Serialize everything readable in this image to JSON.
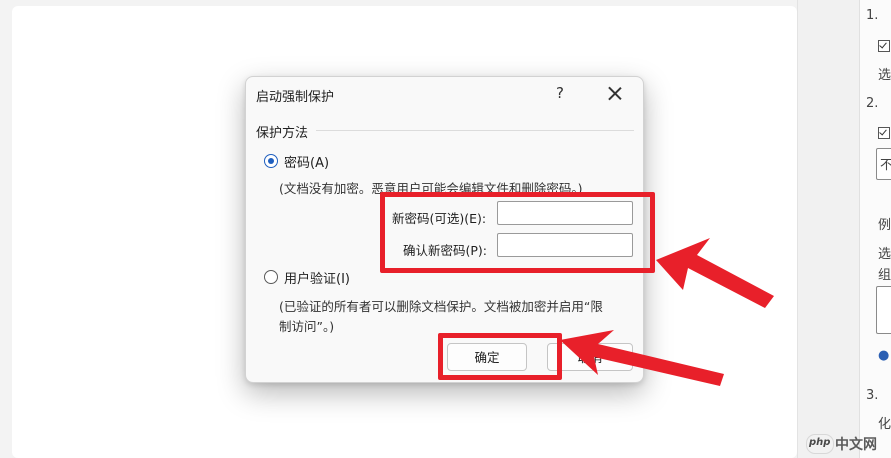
{
  "dialog": {
    "title": "启动强制保护",
    "help": "?",
    "group_label": "保护方法",
    "password_option": {
      "label": "密码(A)",
      "selected": true,
      "description": "(文档没有加密。恶意用户可能会编辑文件和删除密码。)"
    },
    "new_password": {
      "label": "新密码(可选)(E):",
      "value": ""
    },
    "confirm_password": {
      "label": "确认新密码(P):",
      "value": ""
    },
    "user_auth_option": {
      "label": "用户验证(I)",
      "selected": false,
      "description_line1": "(已验证的所有者可以删除文档保护。文档被加密并启用“限",
      "description_line2": "制访问”。)"
    },
    "ok_label": "确定",
    "cancel_label": "取消"
  },
  "side_panel": {
    "item1": "1.",
    "item2": "2.",
    "item3": "3.",
    "frag_a": "选",
    "frag_b": "不",
    "frag_c": "例",
    "frag_d": "选",
    "frag_e": "组",
    "frag_f": "化"
  },
  "watermark": {
    "text": "中文网"
  },
  "annotation_color": "#e8202a",
  "accent_color": "#1f5fbf"
}
